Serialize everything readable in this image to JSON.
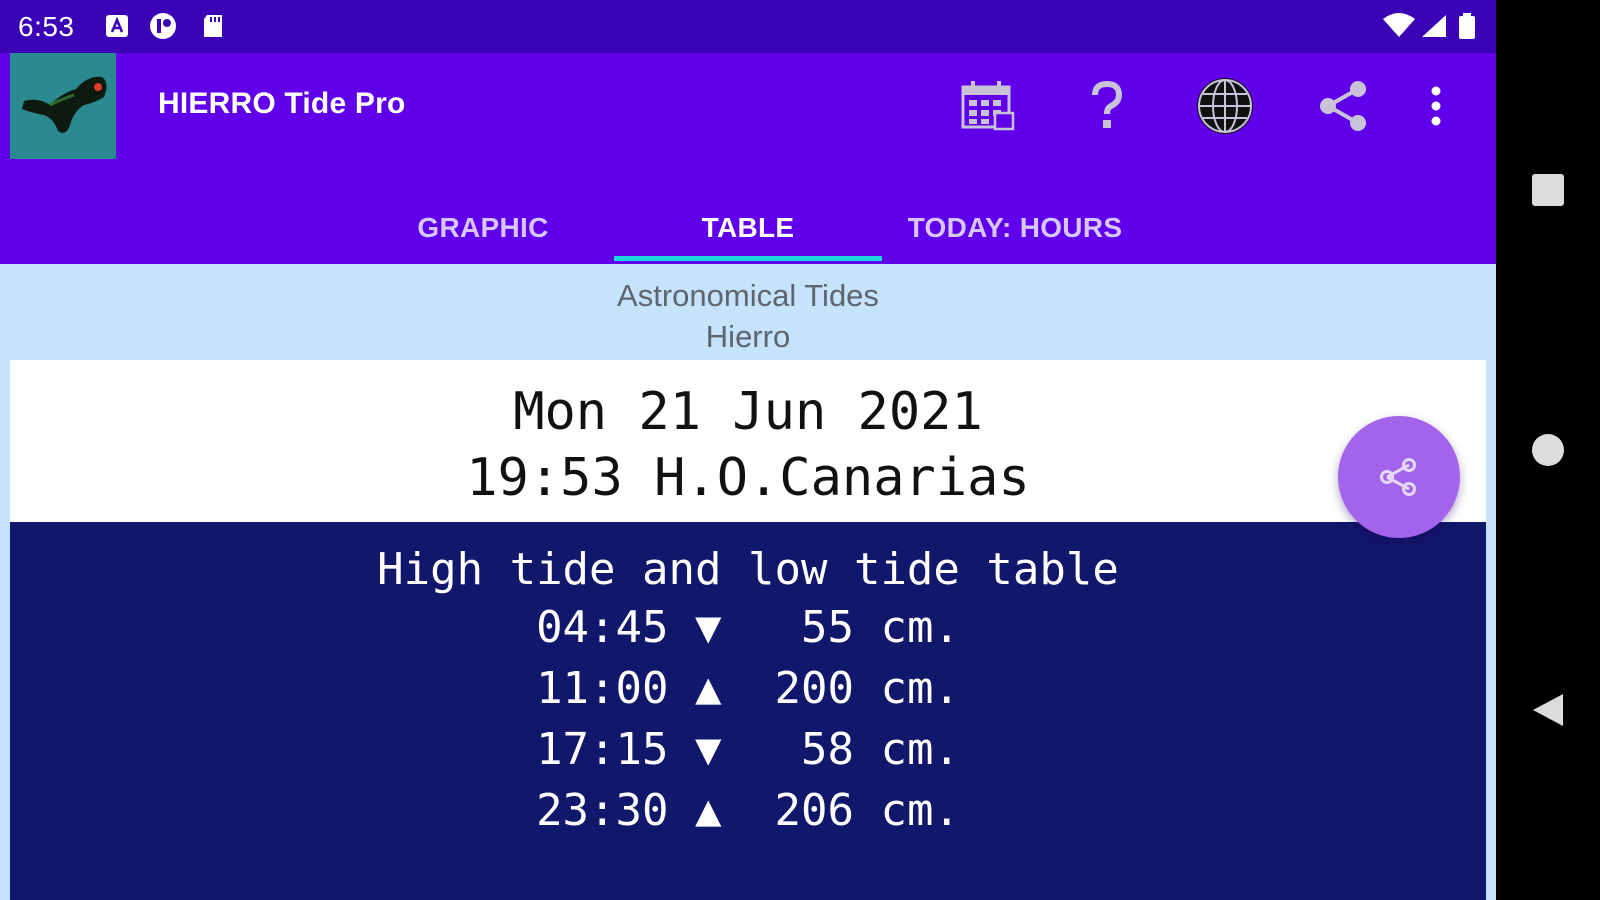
{
  "status_bar": {
    "time": "6:53"
  },
  "app_bar": {
    "title": "HIERRO Tide Pro",
    "actions": [
      "calendar-icon",
      "help-icon",
      "globe-icon",
      "share-icon",
      "overflow-menu-icon"
    ]
  },
  "tabs": [
    {
      "label": "GRAPHIC",
      "active": false
    },
    {
      "label": "TABLE",
      "active": true
    },
    {
      "label": "TODAY: HOURS",
      "active": false
    }
  ],
  "content": {
    "subtitle_line1": "Astronomical Tides",
    "subtitle_line2": "Hierro",
    "date": "Mon 21 Jun 2021",
    "time_zone_line": "19:53 H.O.Canarias",
    "table_heading": "High tide and low tide table",
    "tides": [
      {
        "time": "04:45",
        "arrow": "▼",
        "height": " 55 cm."
      },
      {
        "time": "11:00",
        "arrow": "▲",
        "height": "200 cm."
      },
      {
        "time": "17:15",
        "arrow": "▼",
        "height": " 58 cm."
      },
      {
        "time": "23:30",
        "arrow": "▲",
        "height": "206 cm."
      }
    ]
  },
  "colors": {
    "status_bar": "#3a04b6",
    "app_bar": "#6000ea",
    "tab_indicator": "#1fd5dc",
    "content_bg": "#c7e2fb",
    "table_bg": "#11176b",
    "fab": "#a264ea"
  }
}
